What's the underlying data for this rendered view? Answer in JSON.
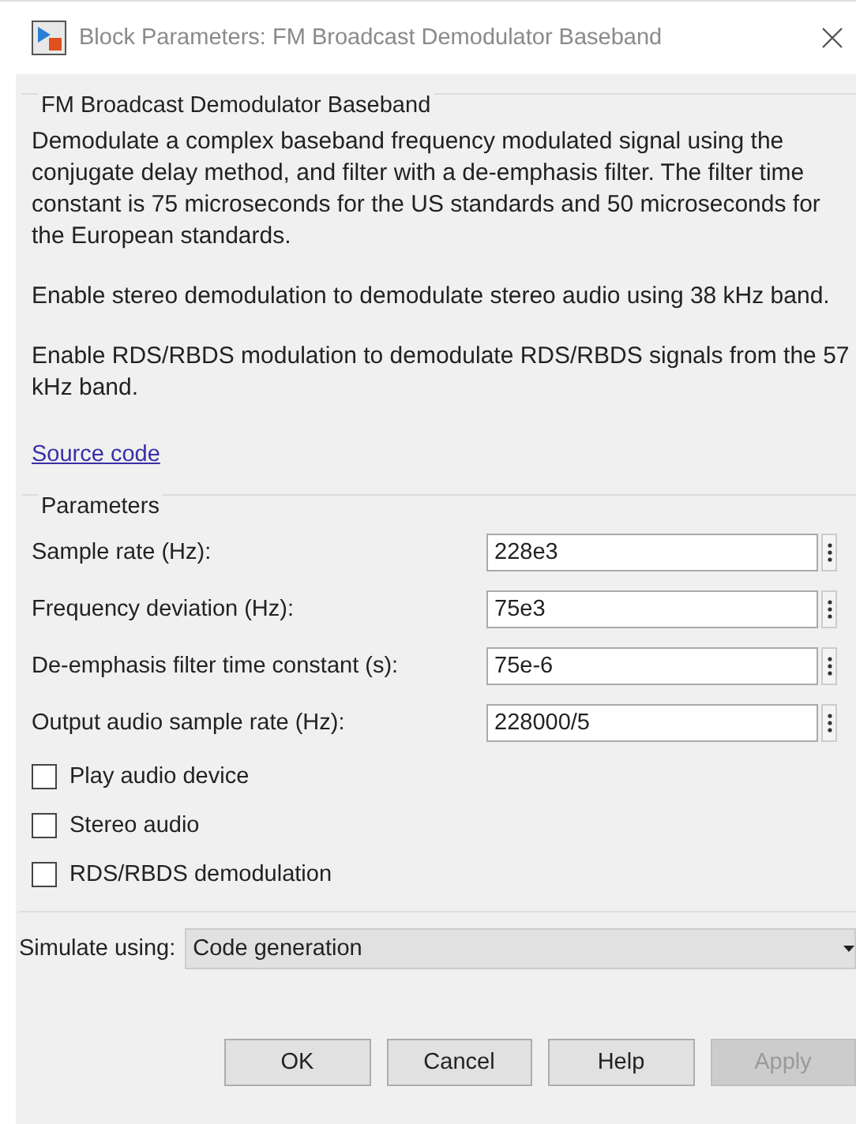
{
  "window": {
    "title": "Block Parameters: FM Broadcast Demodulator Baseband"
  },
  "description": {
    "heading": "FM Broadcast Demodulator Baseband",
    "paragraphs": [
      "Demodulate a complex baseband frequency modulated signal using the conjugate delay method, and filter with a de-emphasis filter. The filter time constant is 75 microseconds for the US standards and 50 microseconds for the European standards.",
      "Enable stereo demodulation to demodulate stereo audio using 38 kHz band.",
      "Enable RDS/RBDS modulation to demodulate RDS/RBDS signals from the 57 kHz band."
    ],
    "link": "Source code"
  },
  "parameters": {
    "heading": "Parameters",
    "fields": [
      {
        "label": "Sample rate (Hz):",
        "value": "228e3"
      },
      {
        "label": "Frequency deviation (Hz):",
        "value": "75e3"
      },
      {
        "label": "De-emphasis filter time constant (s):",
        "value": "75e-6"
      },
      {
        "label": "Output audio sample rate (Hz):",
        "value": "228000/5"
      }
    ],
    "checkboxes": [
      {
        "label": "Play audio device",
        "checked": false
      },
      {
        "label": "Stereo audio",
        "checked": false
      },
      {
        "label": "RDS/RBDS demodulation",
        "checked": false
      }
    ]
  },
  "simulate": {
    "label": "Simulate using:",
    "value": "Code generation"
  },
  "buttons": [
    {
      "label": "OK",
      "disabled": false
    },
    {
      "label": "Cancel",
      "disabled": false
    },
    {
      "label": "Help",
      "disabled": false
    },
    {
      "label": "Apply",
      "disabled": true
    }
  ]
}
